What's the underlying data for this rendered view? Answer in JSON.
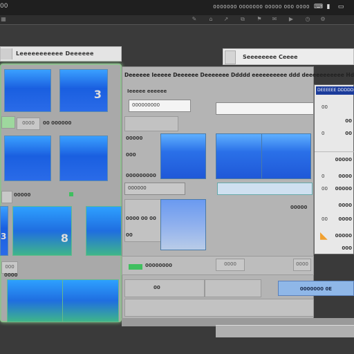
{
  "menubar": {
    "label": "00",
    "status": "0000000 0000000 00000 000 0000",
    "icons": [
      "keyboard-icon",
      "battery-icon",
      "display-icon"
    ]
  },
  "toolbar": {
    "icons": [
      "grid-icon",
      "pen-icon",
      "lock-icon",
      "arrow-icon",
      "copy-icon",
      "flag-icon",
      "mail-icon",
      "play-icon",
      "clock-icon",
      "settings-icon"
    ]
  },
  "left_window": {
    "title": "Leeeeeeeeeee Deeeeee",
    "tiles": [
      {
        "glyph": ""
      },
      {
        "glyph": "3"
      },
      {
        "glyph": ""
      },
      {
        "glyph": ""
      },
      {
        "glyph": "3"
      },
      {
        "glyph": "8"
      },
      {
        "glyph": ""
      },
      {
        "glyph": ""
      }
    ],
    "row_labels": [
      "0000",
      "00 000000"
    ],
    "small_text": [
      "00000",
      "000",
      "0000"
    ]
  },
  "middle_window": {
    "header": "Deeeeee Ieeeee  Deeeeee Deeeeeee  Ddddd  eeeeeeeeee ddd deeeeeeeeeee Hdddd",
    "subheader": "Ieeeee eeeeee",
    "field1": "000000000",
    "field2": "",
    "labels": [
      "00000",
      "000",
      "000000000",
      "000000",
      "0000 00 00",
      "00",
      "0000"
    ],
    "button_labels": [
      "0000",
      "0000"
    ],
    "greenbar_text": "00000000",
    "row_count": "00"
  },
  "right_window": {
    "title": "Seeeeeeee Ceeee",
    "inspector_title": "DEEEEEE DDDDDDD",
    "rows": [
      {
        "left": "00",
        "right": ""
      },
      {
        "left": "",
        "right": "00"
      },
      {
        "left": "0",
        "right": "00"
      },
      {
        "left": "",
        "right": "00000"
      },
      {
        "left": "0",
        "right": "0000"
      },
      {
        "left": "00",
        "right": "00000"
      },
      {
        "left": "",
        "right": "0000"
      },
      {
        "left": "00",
        "right": "0000"
      },
      {
        "left": "",
        "right": "00000"
      },
      {
        "left": "",
        "right": "000"
      }
    ],
    "side_label": "00000",
    "status_button": "0000000 0E"
  }
}
